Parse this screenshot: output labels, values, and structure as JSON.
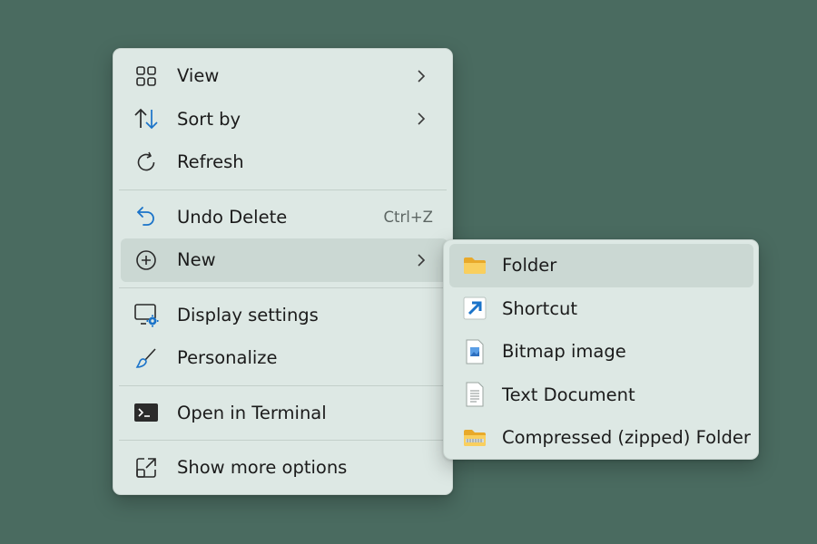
{
  "context_menu": {
    "items": [
      {
        "label": "View",
        "icon": "grid-icon",
        "has_submenu": true
      },
      {
        "label": "Sort by",
        "icon": "sort-icon",
        "has_submenu": true
      },
      {
        "label": "Refresh",
        "icon": "refresh-icon"
      },
      {
        "label": "Undo Delete",
        "icon": "undo-icon",
        "shortcut": "Ctrl+Z"
      },
      {
        "label": "New",
        "icon": "add-circle-icon",
        "has_submenu": true,
        "highlighted": true
      },
      {
        "label": "Display settings",
        "icon": "display-settings-icon"
      },
      {
        "label": "Personalize",
        "icon": "brush-icon"
      },
      {
        "label": "Open in Terminal",
        "icon": "terminal-icon"
      },
      {
        "label": "Show more options",
        "icon": "share-window-icon"
      }
    ]
  },
  "new_submenu": {
    "items": [
      {
        "label": "Folder",
        "icon": "folder-icon",
        "highlighted": true
      },
      {
        "label": "Shortcut",
        "icon": "shortcut-arrow-icon"
      },
      {
        "label": "Bitmap image",
        "icon": "bitmap-file-icon"
      },
      {
        "label": "Text Document",
        "icon": "text-file-icon"
      },
      {
        "label": "Compressed (zipped) Folder",
        "icon": "zip-folder-icon"
      }
    ]
  },
  "colors": {
    "desktop_background": "#4a6b60",
    "menu_background": "#dde8e4",
    "hover_background": "#cbd8d3",
    "accent": "#1a73c9"
  }
}
